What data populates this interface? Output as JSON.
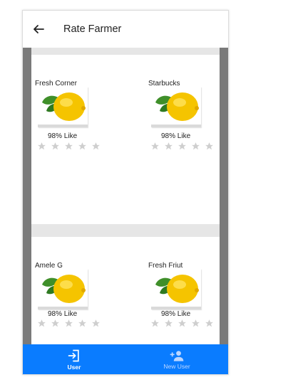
{
  "appbar": {
    "title": "Rate Farmer",
    "back_icon": "arrow-left-icon"
  },
  "cards": [
    {
      "name": "Fresh Corner",
      "like": "98% Like",
      "image": "lemon-image",
      "rating": 0,
      "max_rating": 5
    },
    {
      "name": "Starbucks",
      "like": "98% Like",
      "image": "lemon-image",
      "rating": 0,
      "max_rating": 5
    },
    {
      "name": "Amele G",
      "like": "98% Like",
      "image": "lemon-image",
      "rating": 0,
      "max_rating": 5
    },
    {
      "name": "Fresh Friut",
      "like": "98% Like",
      "image": "lemon-image",
      "rating": 0,
      "max_rating": 5
    }
  ],
  "bottom_nav": {
    "items": [
      {
        "label": "User",
        "icon": "login-icon",
        "active": true
      },
      {
        "label": "New User",
        "icon": "add-user-icon",
        "active": false
      }
    ]
  },
  "colors": {
    "accent": "#0a7cff",
    "content_bg": "#7a7a7a",
    "star_empty": "#cfcfcf"
  }
}
